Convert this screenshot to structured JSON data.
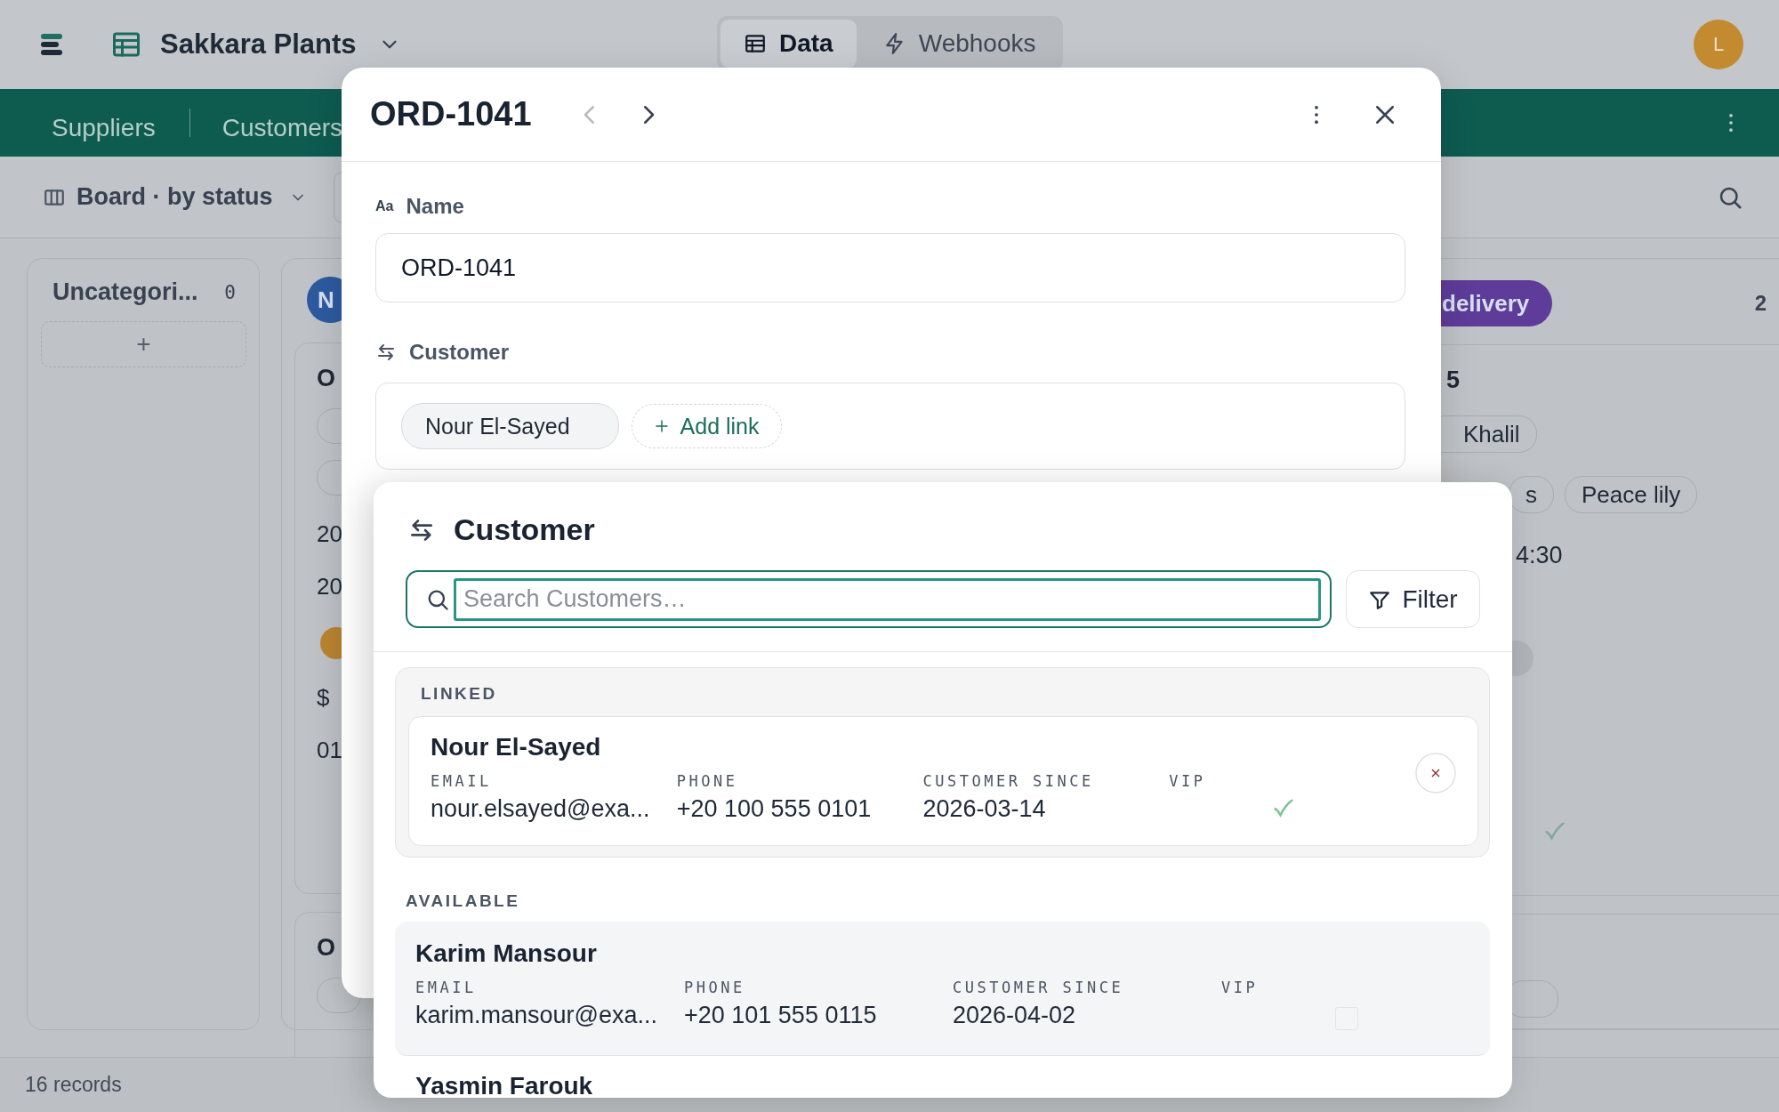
{
  "app": {
    "title": "Sakkara Plants",
    "avatar": "L"
  },
  "view_tabs": [
    {
      "label": "Data",
      "selected": true
    },
    {
      "label": "Webhooks",
      "selected": false
    }
  ],
  "table_tabs": [
    {
      "label": "Suppliers"
    },
    {
      "label": "Customers"
    }
  ],
  "toolbar": {
    "view": "Board · by status"
  },
  "board": {
    "columns": [
      {
        "kind": "empty",
        "title": "Uncategori...",
        "count": "0",
        "add": "+"
      },
      {
        "kind": "left",
        "status": "N",
        "color": "#2d5aa0",
        "cards": [
          {
            "title": "O",
            "items": [
              {
                "kind": "tag"
              },
              {
                "kind": "tag"
              },
              {
                "kind": "text",
                "text": "20"
              },
              {
                "kind": "text",
                "text": "20"
              },
              {
                "kind": "avatar"
              },
              {
                "kind": "text",
                "text": "$"
              },
              {
                "kind": "text",
                "text": "01"
              }
            ]
          },
          {
            "title": "O",
            "items": [
              {
                "kind": "tag"
              }
            ]
          }
        ]
      },
      {
        "kind": "right",
        "status": "delivery",
        "color": "#5e3c99",
        "count": "2",
        "cards": [
          {
            "title": "5",
            "items": [
              {
                "kind": "tags",
                "tags": [
                  "Khalil"
                ]
              },
              {
                "kind": "tags",
                "tags": [
                  "s",
                  "Peace lily"
                ]
              },
              {
                "kind": "text",
                "text": "4:30"
              },
              {
                "kind": "avatar"
              },
              {
                "kind": "check"
              }
            ]
          },
          {
            "items": [
              {
                "kind": "tag"
              }
            ]
          }
        ]
      }
    ]
  },
  "status_bar": "16 records",
  "record": {
    "title": "ORD-1041",
    "fields": [
      {
        "kind": "text",
        "icon": "Aa",
        "label": "Name",
        "value": "ORD-1041"
      },
      {
        "kind": "link",
        "label": "Customer",
        "links": [
          "Nour El-Sayed"
        ],
        "add": "Add link"
      }
    ]
  },
  "picker": {
    "title": "Customer",
    "search": {
      "placeholder": "Search Customers…"
    },
    "filter": "Filter",
    "sections": [
      {
        "kind": "linked",
        "title": "LINKED",
        "records": [
          {
            "name": "Nour El-Sayed",
            "fields": [
              {
                "label": "EMAIL",
                "value": "nour.elsayed@exa..."
              },
              {
                "label": "PHONE",
                "value": "+20 100 555 0101"
              },
              {
                "label": "CUSTOMER SINCE",
                "value": "2026-03-14"
              },
              {
                "label": "VIP",
                "kind": "check",
                "checked": true
              }
            ]
          }
        ]
      },
      {
        "kind": "available",
        "title": "AVAILABLE",
        "records": [
          {
            "name": "Karim Mansour",
            "fields": [
              {
                "label": "EMAIL",
                "value": "karim.mansour@exa..."
              },
              {
                "label": "PHONE",
                "value": "+20 101 555 0115"
              },
              {
                "label": "CUSTOMER SINCE",
                "value": "2026-04-02"
              },
              {
                "label": "VIP",
                "kind": "check",
                "checked": false
              }
            ]
          },
          {
            "name": "Yasmin Farouk"
          }
        ]
      }
    ]
  }
}
